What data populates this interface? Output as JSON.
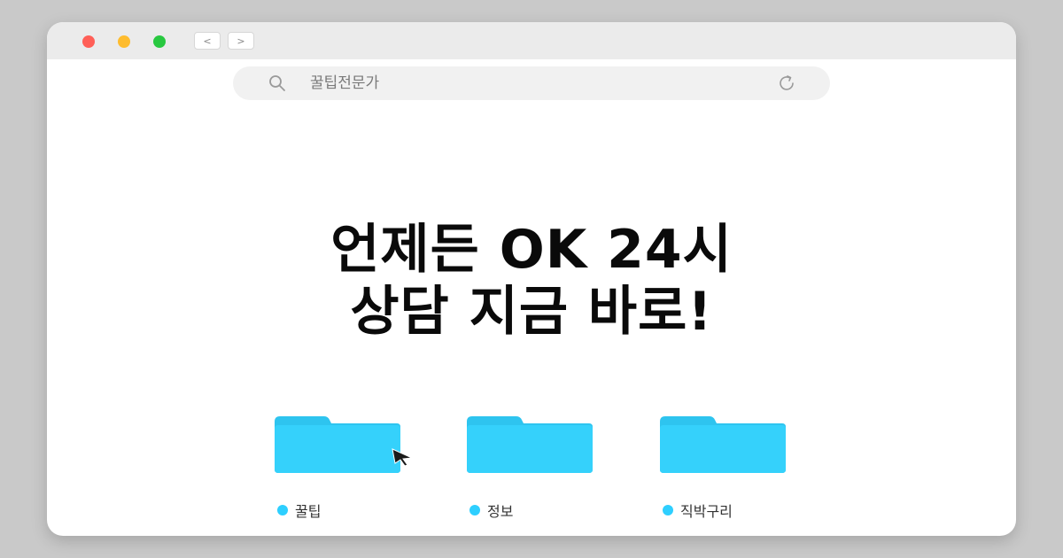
{
  "window": {
    "controls": {
      "close_color": "#ff5f57",
      "minimize_color": "#febc2e",
      "maximize_color": "#28c840"
    },
    "nav": {
      "back_label": "<",
      "forward_label": ">"
    }
  },
  "search": {
    "query": "꿀팁전문가",
    "icon": "search-icon",
    "reload_icon": "reload-icon"
  },
  "headline": {
    "line1": "언제든 OK 24시",
    "line2": "상담 지금 바로!"
  },
  "folders": [
    {
      "label": "꿀팁",
      "icon": "folder-icon"
    },
    {
      "label": "정보",
      "icon": "folder-icon"
    },
    {
      "label": "직박구리",
      "icon": "folder-icon"
    }
  ],
  "colors": {
    "folder_fill": "#35d1fb",
    "folder_tab": "#2ec4ef",
    "label_dot": "#2ecfff"
  }
}
